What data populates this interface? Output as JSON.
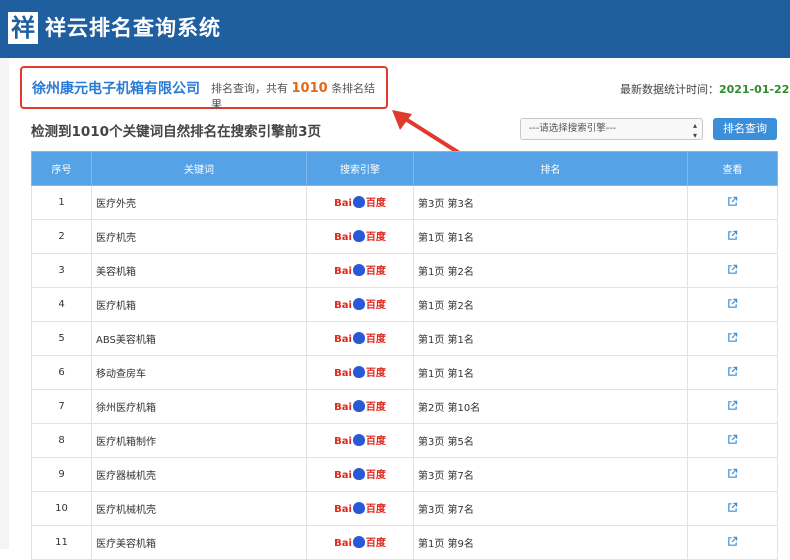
{
  "header": {
    "logo_char": "祥",
    "title": "祥云排名查询系统"
  },
  "company": {
    "name": "徐州康元电子机箱有限公司",
    "sub_prefix": "排名查询，共有",
    "count": "1010",
    "sub_suffix": "条排名结果"
  },
  "stats": {
    "label": "最新数据统计时间：",
    "date": "2021-01-22"
  },
  "summary": "检测到1010个关键词自然排名在搜索引擎前3页",
  "engine_select": {
    "value": "---请选择搜索引擎---"
  },
  "query_button": "排名查询",
  "table": {
    "headers": [
      "序号",
      "关键词",
      "搜索引擎",
      "排名",
      "查看"
    ],
    "engine": {
      "bai": "Bai",
      "du": "百度"
    },
    "rows": [
      {
        "no": "1",
        "keyword": "医疗外壳",
        "rank": "第3页 第3名"
      },
      {
        "no": "2",
        "keyword": "医疗机壳",
        "rank": "第1页 第1名"
      },
      {
        "no": "3",
        "keyword": "美容机箱",
        "rank": "第1页 第2名"
      },
      {
        "no": "4",
        "keyword": "医疗机箱",
        "rank": "第1页 第2名"
      },
      {
        "no": "5",
        "keyword": "ABS美容机箱",
        "rank": "第1页 第1名"
      },
      {
        "no": "6",
        "keyword": "移动查房车",
        "rank": "第1页 第1名"
      },
      {
        "no": "7",
        "keyword": "徐州医疗机箱",
        "rank": "第2页 第10名"
      },
      {
        "no": "8",
        "keyword": "医疗机箱制作",
        "rank": "第3页 第5名"
      },
      {
        "no": "9",
        "keyword": "医疗器械机壳",
        "rank": "第3页 第7名"
      },
      {
        "no": "10",
        "keyword": "医疗机械机壳",
        "rank": "第3页 第7名"
      },
      {
        "no": "11",
        "keyword": "医疗美容机箱",
        "rank": "第1页 第9名"
      }
    ]
  },
  "colors": {
    "header": "#1f5fa0",
    "accent": "#e03a2e",
    "table_header": "#56a2e6",
    "date": "#2e8b2e"
  }
}
